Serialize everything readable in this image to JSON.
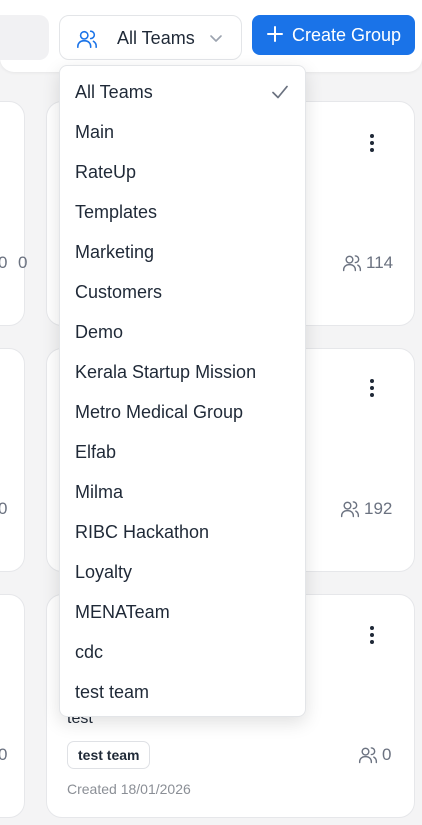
{
  "toolbar": {
    "team_filter_label": "All Teams",
    "create_button_label": "Create Group"
  },
  "dropdown": {
    "selected": "All Teams",
    "items": [
      "All Teams",
      "Main",
      "RateUp",
      "Templates",
      "Marketing",
      "Customers",
      "Demo",
      "Kerala Startup Mission",
      "Metro Medical Group",
      "Elfab",
      "Milma",
      "RIBC Hackathon",
      "Loyalty",
      "MENATeam",
      "cdc",
      "test team"
    ]
  },
  "cards": {
    "left_fragments": [
      "0",
      "0",
      "0"
    ],
    "right": [
      {
        "member_count": "114"
      },
      {
        "member_count": "192"
      },
      {
        "description": "test",
        "team_chip": "test team",
        "member_count": "0",
        "created": "Created 18/01/2026"
      }
    ]
  },
  "colors": {
    "accent": "#1a73e8",
    "background": "#f4f4f5",
    "card": "#ffffff",
    "muted_text": "#6b7280"
  },
  "icons": {
    "team_filter": "users-icon",
    "dropdown_chevron": "chevron-down-icon",
    "create": "plus-icon",
    "selected_check": "check-icon",
    "card_menu": "more-vertical-icon",
    "members": "users-icon"
  }
}
